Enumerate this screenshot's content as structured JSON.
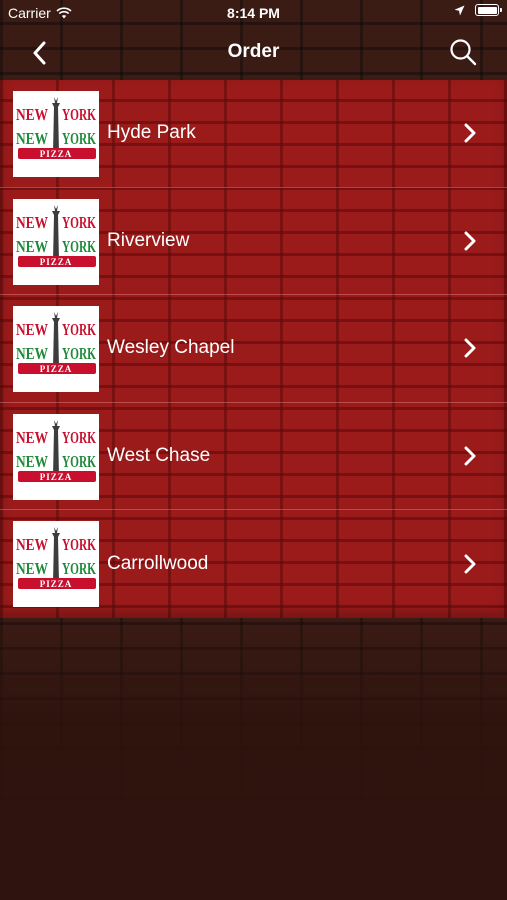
{
  "status_bar": {
    "carrier": "Carrier",
    "time": "8:14 PM"
  },
  "nav": {
    "title": "Order",
    "back_icon": "chevron-left-icon",
    "search_icon": "search-icon"
  },
  "logo": {
    "line1_left": "NEW",
    "line1_right": "YORK",
    "line2_left": "NEW",
    "line2_right": "YORK",
    "banner": "PIZZA"
  },
  "locations": [
    {
      "label": "Hyde Park"
    },
    {
      "label": "Riverview"
    },
    {
      "label": "Wesley Chapel"
    },
    {
      "label": "West Chase"
    },
    {
      "label": "Carrollwood"
    }
  ],
  "colors": {
    "list_background": "#9b1b1b",
    "logo_red": "#c8102e",
    "logo_green": "#1f8a3a",
    "text": "#ffffff"
  }
}
